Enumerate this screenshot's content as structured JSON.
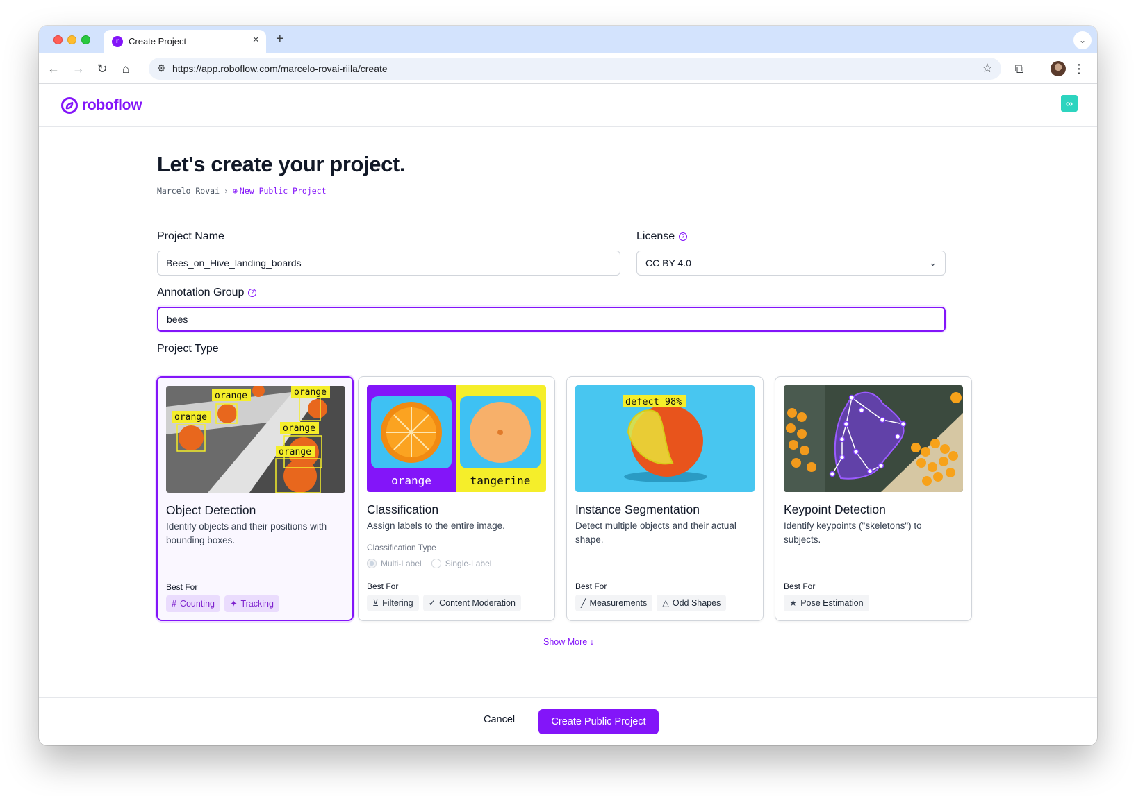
{
  "browser": {
    "tab_title": "Create Project",
    "url": "https://app.roboflow.com/marcelo-rovai-riila/create"
  },
  "app": {
    "logo_text": "roboflow",
    "brand_color": "#8315f9"
  },
  "page": {
    "title": "Let's create your project.",
    "breadcrumb": {
      "owner": "Marcelo Rovai",
      "current": "New Public Project"
    }
  },
  "form": {
    "project_name": {
      "label": "Project Name",
      "value": "Bees_on_Hive_landing_boards"
    },
    "license": {
      "label": "License",
      "value": "CC BY 4.0"
    },
    "annotation_group": {
      "label": "Annotation Group",
      "value": "bees"
    },
    "project_type_label": "Project Type"
  },
  "project_types": [
    {
      "title": "Object Detection",
      "description": "Identify objects and their positions with bounding boxes.",
      "best_for_label": "Best For",
      "tags": [
        {
          "icon": "#",
          "label": "Counting"
        },
        {
          "icon": "✦",
          "label": "Tracking"
        }
      ],
      "image_labels": [
        "orange",
        "orange",
        "orange",
        "orange",
        "orange"
      ],
      "selected": true
    },
    {
      "title": "Classification",
      "description": "Assign labels to the entire image.",
      "classification_type_label": "Classification Type",
      "options": [
        "Multi-Label",
        "Single-Label"
      ],
      "best_for_label": "Best For",
      "tags": [
        {
          "icon": "⊻",
          "label": "Filtering"
        },
        {
          "icon": "✓",
          "label": "Content Moderation"
        }
      ],
      "image_labels": [
        "orange",
        "tangerine"
      ]
    },
    {
      "title": "Instance Segmentation",
      "description": "Detect multiple objects and their actual shape.",
      "best_for_label": "Best For",
      "tags": [
        {
          "icon": "╱",
          "label": "Measurements"
        },
        {
          "icon": "△",
          "label": "Odd Shapes"
        }
      ],
      "image_labels": [
        "defect 98%"
      ]
    },
    {
      "title": "Keypoint Detection",
      "description": "Identify keypoints (\"skeletons\") to subjects.",
      "best_for_label": "Best For",
      "tags": [
        {
          "icon": "★",
          "label": "Pose Estimation"
        }
      ]
    }
  ],
  "show_more": "Show More",
  "footer": {
    "cancel": "Cancel",
    "create": "Create Public Project"
  }
}
